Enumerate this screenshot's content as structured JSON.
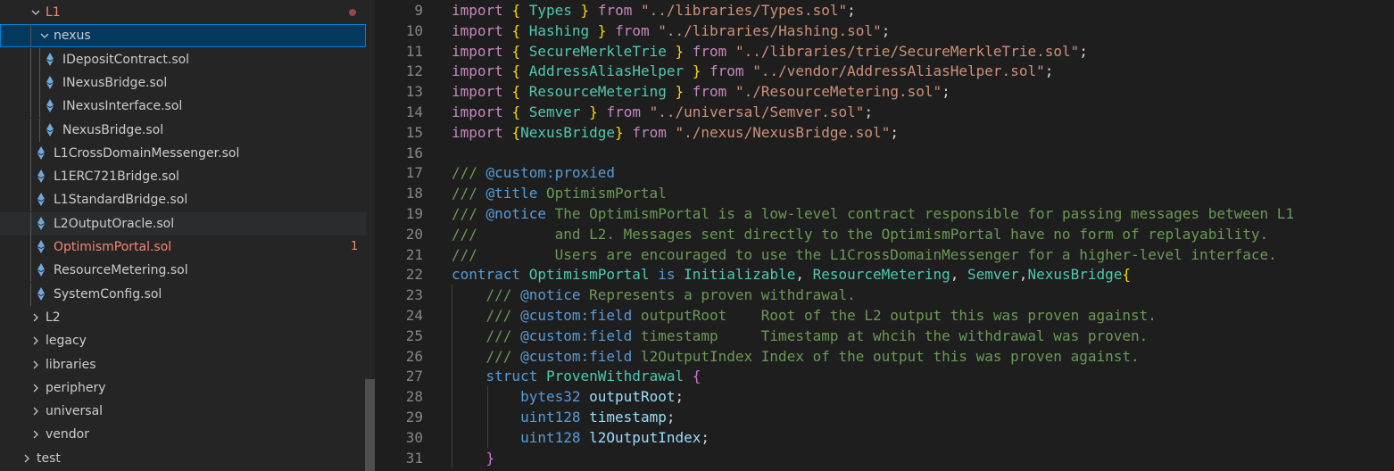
{
  "explorer": {
    "items": [
      {
        "label": "L1",
        "kind": "folder",
        "open": true,
        "depth": 0,
        "badge": "dot",
        "error": true
      },
      {
        "label": "nexus",
        "kind": "folder",
        "open": true,
        "depth": 1,
        "state": "selected"
      },
      {
        "label": "IDepositContract.sol",
        "kind": "file",
        "depth": 2
      },
      {
        "label": "INexusBridge.sol",
        "kind": "file",
        "depth": 2
      },
      {
        "label": "INexusInterface.sol",
        "kind": "file",
        "depth": 2
      },
      {
        "label": "NexusBridge.sol",
        "kind": "file",
        "depth": 2
      },
      {
        "label": "L1CrossDomainMessenger.sol",
        "kind": "file",
        "depth": 1
      },
      {
        "label": "L1ERC721Bridge.sol",
        "kind": "file",
        "depth": 1
      },
      {
        "label": "L1StandardBridge.sol",
        "kind": "file",
        "depth": 1
      },
      {
        "label": "L2OutputOracle.sol",
        "kind": "file",
        "depth": 1,
        "state": "hover"
      },
      {
        "label": "OptimismPortal.sol",
        "kind": "file",
        "depth": 1,
        "error": true,
        "badge": "1"
      },
      {
        "label": "ResourceMetering.sol",
        "kind": "file",
        "depth": 1
      },
      {
        "label": "SystemConfig.sol",
        "kind": "file",
        "depth": 1
      },
      {
        "label": "L2",
        "kind": "folder",
        "open": false,
        "depth": 0
      },
      {
        "label": "legacy",
        "kind": "folder",
        "open": false,
        "depth": 0
      },
      {
        "label": "libraries",
        "kind": "folder",
        "open": false,
        "depth": 0
      },
      {
        "label": "periphery",
        "kind": "folder",
        "open": false,
        "depth": 0
      },
      {
        "label": "universal",
        "kind": "folder",
        "open": false,
        "depth": 0
      },
      {
        "label": "vendor",
        "kind": "folder",
        "open": false,
        "depth": 0
      },
      {
        "label": "test",
        "kind": "folder",
        "open": false,
        "depth": -1
      }
    ]
  },
  "editor": {
    "lines": [
      {
        "n": "9",
        "tokens": [
          [
            "import",
            "kw"
          ],
          [
            " ",
            ""
          ],
          [
            "{",
            "b1"
          ],
          [
            " ",
            ""
          ],
          [
            "Types",
            "cls"
          ],
          [
            " ",
            ""
          ],
          [
            "}",
            "b1"
          ],
          [
            " ",
            ""
          ],
          [
            "from",
            "kw"
          ],
          [
            " ",
            ""
          ],
          [
            "\"../libraries/Types.sol\"",
            "str"
          ],
          [
            ";",
            "txt"
          ]
        ]
      },
      {
        "n": "10",
        "tokens": [
          [
            "import",
            "kw"
          ],
          [
            " ",
            ""
          ],
          [
            "{",
            "b1"
          ],
          [
            " ",
            ""
          ],
          [
            "Hashing",
            "cls"
          ],
          [
            " ",
            ""
          ],
          [
            "}",
            "b1"
          ],
          [
            " ",
            ""
          ],
          [
            "from",
            "kw"
          ],
          [
            " ",
            ""
          ],
          [
            "\"../libraries/Hashing.sol\"",
            "str"
          ],
          [
            ";",
            "txt"
          ]
        ]
      },
      {
        "n": "11",
        "tokens": [
          [
            "import",
            "kw"
          ],
          [
            " ",
            ""
          ],
          [
            "{",
            "b1"
          ],
          [
            " ",
            ""
          ],
          [
            "SecureMerkleTrie",
            "cls"
          ],
          [
            " ",
            ""
          ],
          [
            "}",
            "b1"
          ],
          [
            " ",
            ""
          ],
          [
            "from",
            "kw"
          ],
          [
            " ",
            ""
          ],
          [
            "\"../libraries/trie/SecureMerkleTrie.sol\"",
            "str"
          ],
          [
            ";",
            "txt"
          ]
        ]
      },
      {
        "n": "12",
        "tokens": [
          [
            "import",
            "kw"
          ],
          [
            " ",
            ""
          ],
          [
            "{",
            "b1"
          ],
          [
            " ",
            ""
          ],
          [
            "AddressAliasHelper",
            "cls"
          ],
          [
            " ",
            ""
          ],
          [
            "}",
            "b1"
          ],
          [
            " ",
            ""
          ],
          [
            "from",
            "kw"
          ],
          [
            " ",
            ""
          ],
          [
            "\"../vendor/AddressAliasHelper.sol\"",
            "str"
          ],
          [
            ";",
            "txt"
          ]
        ]
      },
      {
        "n": "13",
        "tokens": [
          [
            "import",
            "kw"
          ],
          [
            " ",
            ""
          ],
          [
            "{",
            "b1"
          ],
          [
            " ",
            ""
          ],
          [
            "ResourceMetering",
            "cls"
          ],
          [
            " ",
            ""
          ],
          [
            "}",
            "b1"
          ],
          [
            " ",
            ""
          ],
          [
            "from",
            "kw"
          ],
          [
            " ",
            ""
          ],
          [
            "\"./ResourceMetering.sol\"",
            "str"
          ],
          [
            ";",
            "txt"
          ]
        ]
      },
      {
        "n": "14",
        "tokens": [
          [
            "import",
            "kw"
          ],
          [
            " ",
            ""
          ],
          [
            "{",
            "b1"
          ],
          [
            " ",
            ""
          ],
          [
            "Semver",
            "cls"
          ],
          [
            " ",
            ""
          ],
          [
            "}",
            "b1"
          ],
          [
            " ",
            ""
          ],
          [
            "from",
            "kw"
          ],
          [
            " ",
            ""
          ],
          [
            "\"../universal/Semver.sol\"",
            "str"
          ],
          [
            ";",
            "txt"
          ]
        ]
      },
      {
        "n": "15",
        "tokens": [
          [
            "import",
            "kw"
          ],
          [
            " ",
            ""
          ],
          [
            "{",
            "b1"
          ],
          [
            "NexusBridge",
            "cls"
          ],
          [
            "}",
            "b1"
          ],
          [
            " ",
            ""
          ],
          [
            "from",
            "kw"
          ],
          [
            " ",
            ""
          ],
          [
            "\"./nexus/NexusBridge.sol\"",
            "str"
          ],
          [
            ";",
            "txt"
          ]
        ]
      },
      {
        "n": "16",
        "tokens": []
      },
      {
        "n": "17",
        "tokens": [
          [
            "/// ",
            "cm"
          ],
          [
            "@custom:proxied",
            "tag"
          ]
        ]
      },
      {
        "n": "18",
        "tokens": [
          [
            "/// ",
            "cm"
          ],
          [
            "@title",
            "tag"
          ],
          [
            " OptimismPortal",
            "cm"
          ]
        ]
      },
      {
        "n": "19",
        "tokens": [
          [
            "/// ",
            "cm"
          ],
          [
            "@notice",
            "tag"
          ],
          [
            " The OptimismPortal is a low-level contract responsible for passing messages between L1",
            "cm"
          ]
        ]
      },
      {
        "n": "20",
        "tokens": [
          [
            "///         and L2. Messages sent directly to the OptimismPortal have no form of replayability.",
            "cm"
          ]
        ]
      },
      {
        "n": "21",
        "tokens": [
          [
            "///         Users are encouraged to use the L1CrossDomainMessenger for a higher-level interface.",
            "cm"
          ]
        ]
      },
      {
        "n": "22",
        "tokens": [
          [
            "contract",
            "ty"
          ],
          [
            " ",
            ""
          ],
          [
            "OptimismPortal",
            "cls"
          ],
          [
            " ",
            ""
          ],
          [
            "is",
            "ty"
          ],
          [
            " ",
            ""
          ],
          [
            "Initializable",
            "cls"
          ],
          [
            ", ",
            "txt"
          ],
          [
            "ResourceMetering",
            "cls"
          ],
          [
            ", ",
            "txt"
          ],
          [
            "Semver",
            "cls"
          ],
          [
            ",",
            "txt"
          ],
          [
            "NexusBridge",
            "cls"
          ],
          [
            "{",
            "b1"
          ]
        ]
      },
      {
        "n": "23",
        "tokens": [
          [
            "    /// ",
            "cm"
          ],
          [
            "@notice",
            "tag"
          ],
          [
            " Represents a proven withdrawal.",
            "cm"
          ]
        ]
      },
      {
        "n": "24",
        "tokens": [
          [
            "    /// ",
            "cm"
          ],
          [
            "@custom:field",
            "tag"
          ],
          [
            " outputRoot    Root of the L2 output this was proven against.",
            "cm"
          ]
        ]
      },
      {
        "n": "25",
        "tokens": [
          [
            "    /// ",
            "cm"
          ],
          [
            "@custom:field",
            "tag"
          ],
          [
            " timestamp     Timestamp at whcih the withdrawal was proven.",
            "cm"
          ]
        ]
      },
      {
        "n": "26",
        "tokens": [
          [
            "    /// ",
            "cm"
          ],
          [
            "@custom:field",
            "tag"
          ],
          [
            " l2OutputIndex Index of the output this was proven against.",
            "cm"
          ]
        ]
      },
      {
        "n": "27",
        "tokens": [
          [
            "    ",
            ""
          ],
          [
            "struct",
            "ty"
          ],
          [
            " ",
            ""
          ],
          [
            "ProvenWithdrawal",
            "cls"
          ],
          [
            " ",
            ""
          ],
          [
            "{",
            "b2"
          ]
        ]
      },
      {
        "n": "28",
        "tokens": [
          [
            "        ",
            ""
          ],
          [
            "bytes32",
            "ty"
          ],
          [
            " ",
            ""
          ],
          [
            "outputRoot",
            "var"
          ],
          [
            ";",
            "txt"
          ]
        ]
      },
      {
        "n": "29",
        "tokens": [
          [
            "        ",
            ""
          ],
          [
            "uint128",
            "ty"
          ],
          [
            " ",
            ""
          ],
          [
            "timestamp",
            "var"
          ],
          [
            ";",
            "txt"
          ]
        ]
      },
      {
        "n": "30",
        "tokens": [
          [
            "        ",
            ""
          ],
          [
            "uint128",
            "ty"
          ],
          [
            " ",
            ""
          ],
          [
            "l2OutputIndex",
            "var"
          ],
          [
            ";",
            "txt"
          ]
        ]
      },
      {
        "n": "31",
        "tokens": [
          [
            "    ",
            ""
          ],
          [
            "}",
            "b2"
          ]
        ]
      }
    ]
  }
}
